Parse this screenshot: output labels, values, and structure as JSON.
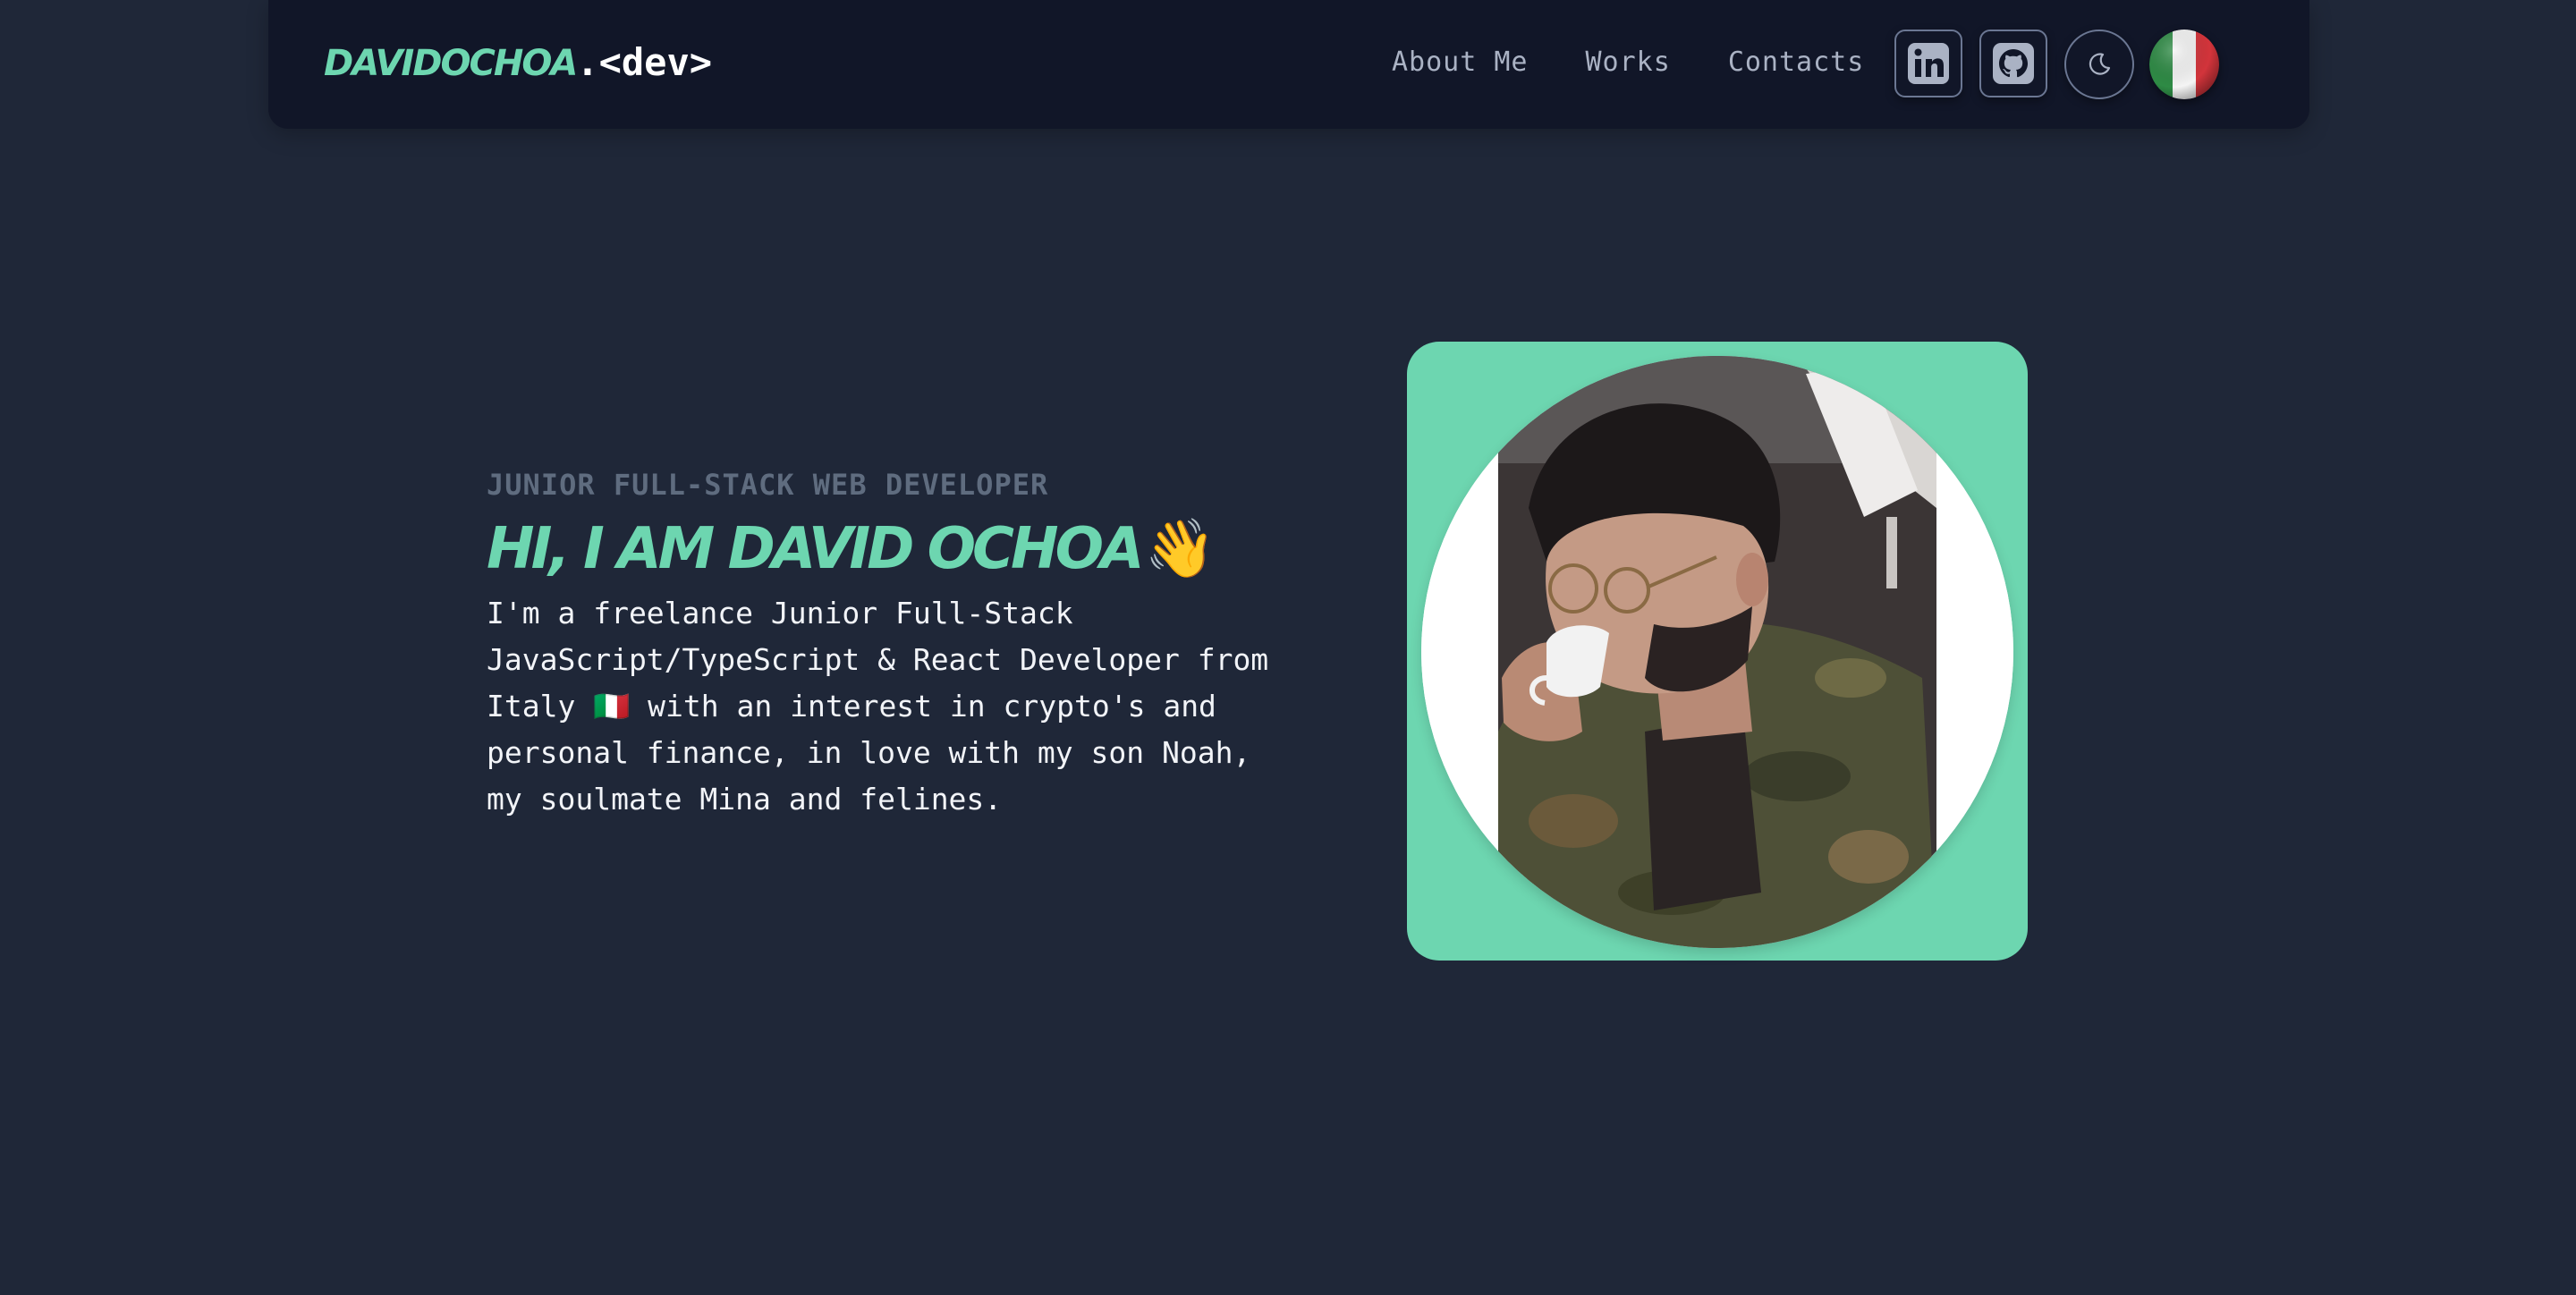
{
  "header": {
    "logo_name": "DAVIDOCHOA",
    "logo_suffix": ".<dev>",
    "nav": [
      {
        "label": "About Me"
      },
      {
        "label": "Works"
      },
      {
        "label": "Contacts"
      }
    ],
    "icons": {
      "linkedin": "linkedin-icon",
      "github": "github-icon",
      "theme": "moon-icon",
      "language": "italy-flag-icon"
    }
  },
  "hero": {
    "subtitle": "JUNIOR FULL-STACK WEB DEVELOPER",
    "headline": "HI, I AM DAVID OCHOA",
    "wave_emoji": "👋",
    "bio": "I'm a freelance Junior Full-Stack JavaScript/TypeScript & React Developer from Italy 🇮🇹 with an interest in crypto's and personal finance, in love with my son Noah, my soulmate Mina and felines."
  },
  "colors": {
    "background": "#1f2738",
    "navbar": "#111628",
    "accent": "#6dd6b0",
    "muted_text": "#5f6c7f",
    "nav_text": "#aab2c4",
    "body_text": "#f2f4f8"
  }
}
